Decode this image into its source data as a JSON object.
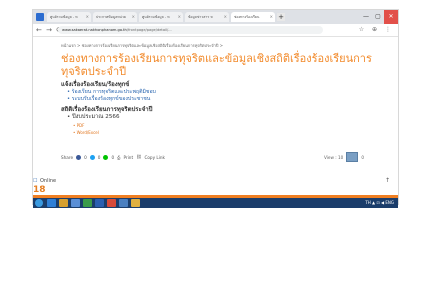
{
  "browser": {
    "tabs": [
      {
        "label": "ศูนย์รวมข้อมูล - ห"
      },
      {
        "label": "ประกาศข้อมูลหน่วย"
      },
      {
        "label": "ศูนย์รวมข้อมูล - ห"
      },
      {
        "label": "ข้อมูลข่าวสาร ห"
      },
      {
        "label": "ช่องทางร้องเรียน",
        "active": true
      }
    ],
    "new_tab": "+",
    "window_buttons": {
      "minimize": "—",
      "maximize": "▢",
      "close": "✕"
    },
    "nav": {
      "back": "←",
      "forward": "→",
      "reload": "⟳"
    },
    "url_domain": "www.sakaerat.nakhonphanom.go.th",
    "url_path": "/frontpage/page/detail/...",
    "toolbar_icons": "☆ ⊕ ⋮"
  },
  "page": {
    "breadcrumb": "หน้าแรก > ช่องทางการร้องเรียนการทุจริตและข้อมูลเชิงสถิติเรื่องร้องเรียนการทุจริตประจำปี >",
    "title": "ช่องทางการร้องเรียนการทุจริตและข้อมูลเชิงสถิติเรื่องร้องเรียนการทุจริตประจำปี",
    "section1_heading": "แจ้งเรื่องร้องเรียน/ร้องทุกข์",
    "section1_items": [
      "ร้องเรียน การทุจริตและประพฤติมิชอบ",
      "ระบบรับเรื่องร้องทุกข์ของประชาชน"
    ],
    "section2_heading": "สถิติเรื่องร้องเรียนการทุจริตประจำปี",
    "fiscal_year": "ปีงบประมาณ 2566",
    "files": [
      "PDF",
      "Word/Excel"
    ],
    "share": {
      "label": "Share",
      "fb": "0",
      "tw": "0",
      "line": "0",
      "print": "Print",
      "copy": "Copy Link"
    },
    "view": {
      "label": "View : 10",
      "gallery_count": "0"
    },
    "online_label": "Online",
    "online_count": "18",
    "to_top": "↑"
  },
  "taskbar": {
    "tray": "TH  ▲  ⊡  ◀  ENG"
  }
}
